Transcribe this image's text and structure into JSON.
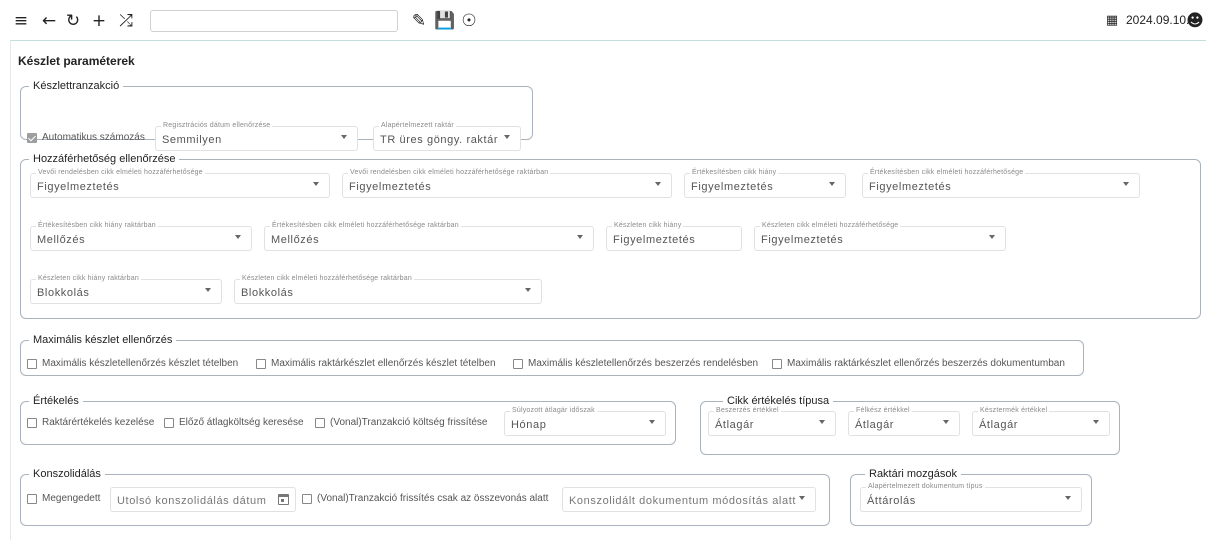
{
  "toolbar": {
    "icons": [
      "menu-icon",
      "back-arrow-icon",
      "refresh-icon",
      "plus-icon",
      "shuffle-icon",
      "pencil-icon",
      "save-icon",
      "user-circle-icon",
      "calendar-icon",
      "account-icon"
    ],
    "search_value": "",
    "date": "2024.09.10."
  },
  "page_title": "Készlet paraméterek",
  "keszlettranzakcio": {
    "legend": "Készlettranzakció",
    "auto_numbering": {
      "label": "Automatikus számozás",
      "checked": true
    },
    "reg_date_check": {
      "label": "Regisztrációs dátum ellenőrzése",
      "value": "Semmilyen"
    },
    "default_warehouse": {
      "label": "Alapértelmezett raktár",
      "value": "TR üres göngy. raktár"
    }
  },
  "hozzaferhetoseg": {
    "legend": "Hozzáférhetőség ellenőrzése",
    "fields": [
      {
        "label": "Vevői rendelésben cikk elméleti hozzáférhetősége",
        "value": "Figyelmeztetés"
      },
      {
        "label": "Vevői rendelésben cikk elméleti hozzáférhetősége raktárban",
        "value": "Figyelmeztetés"
      },
      {
        "label": "Értékesítésben cikk hiány",
        "value": "Figyelmeztetés"
      },
      {
        "label": "Értékesítésben cikk elméleti hozzáférhetősége",
        "value": "Figyelmeztetés"
      },
      {
        "label": "Értékesítésben cikk hiány raktárban",
        "value": "Mellőzés"
      },
      {
        "label": "Értékesítésben cikk elméleti hozzáférhetősége raktárban",
        "value": "Mellőzés"
      },
      {
        "label": "Készleten cikk hiány",
        "value": "Figyelmeztetés"
      },
      {
        "label": "Készleten cikk elméleti hozzáférhetősége",
        "value": "Figyelmeztetés"
      },
      {
        "label": "Készleten cikk hiány raktárban",
        "value": "Blokkolás"
      },
      {
        "label": "Készleten cikk elméleti hozzáférhetősége raktárban",
        "value": "Blokkolás"
      }
    ]
  },
  "max_keszlet": {
    "legend": "Maximális készlet ellenőrzés",
    "checkboxes": [
      {
        "label": "Maximális készletellenőrzés készlet tételben",
        "checked": false
      },
      {
        "label": "Maximális raktárkészlet ellenőrzés készlet tételben",
        "checked": false
      },
      {
        "label": "Maximális készletellenőrzés beszerzés rendelésben",
        "checked": false
      },
      {
        "label": "Maximális raktárkészlet ellenőrzés beszerzés dokumentumban",
        "checked": false
      }
    ]
  },
  "ertekeles": {
    "legend": "Értékelés",
    "checkboxes": [
      {
        "label": "Raktárértékelés kezelése",
        "checked": false
      },
      {
        "label": "Előző átlagköltség keresése",
        "checked": false
      },
      {
        "label": "(Vonal)Tranzakció költség frissítése",
        "checked": false
      }
    ],
    "period": {
      "label": "Súlyozott átlagár időszak",
      "value": "Hónap"
    }
  },
  "cikk_ertekeles": {
    "legend": "Cikk értékelés típusa",
    "fields": [
      {
        "label": "Beszerzés értékkel",
        "value": "Átlagár"
      },
      {
        "label": "Félkész értékkel",
        "value": "Átlagár"
      },
      {
        "label": "Késztermék értékkel",
        "value": "Átlagár"
      }
    ]
  },
  "konszolidalas": {
    "legend": "Konszolidálás",
    "allowed": {
      "label": "Megengedett",
      "checked": false
    },
    "last_date_placeholder": "Utolsó konszolidálás dátum",
    "refresh": {
      "label": "(Vonal)Tranzakció frissítés csak az összevonás alatt",
      "checked": false
    },
    "modify_placeholder": "Konszolidált dokumentum módosítás alatt"
  },
  "raktari_mozgasok": {
    "legend": "Raktári mozgások",
    "doc_type": {
      "label": "Alapértelmezett dokumentum típus",
      "value": "Áttárolás"
    }
  }
}
